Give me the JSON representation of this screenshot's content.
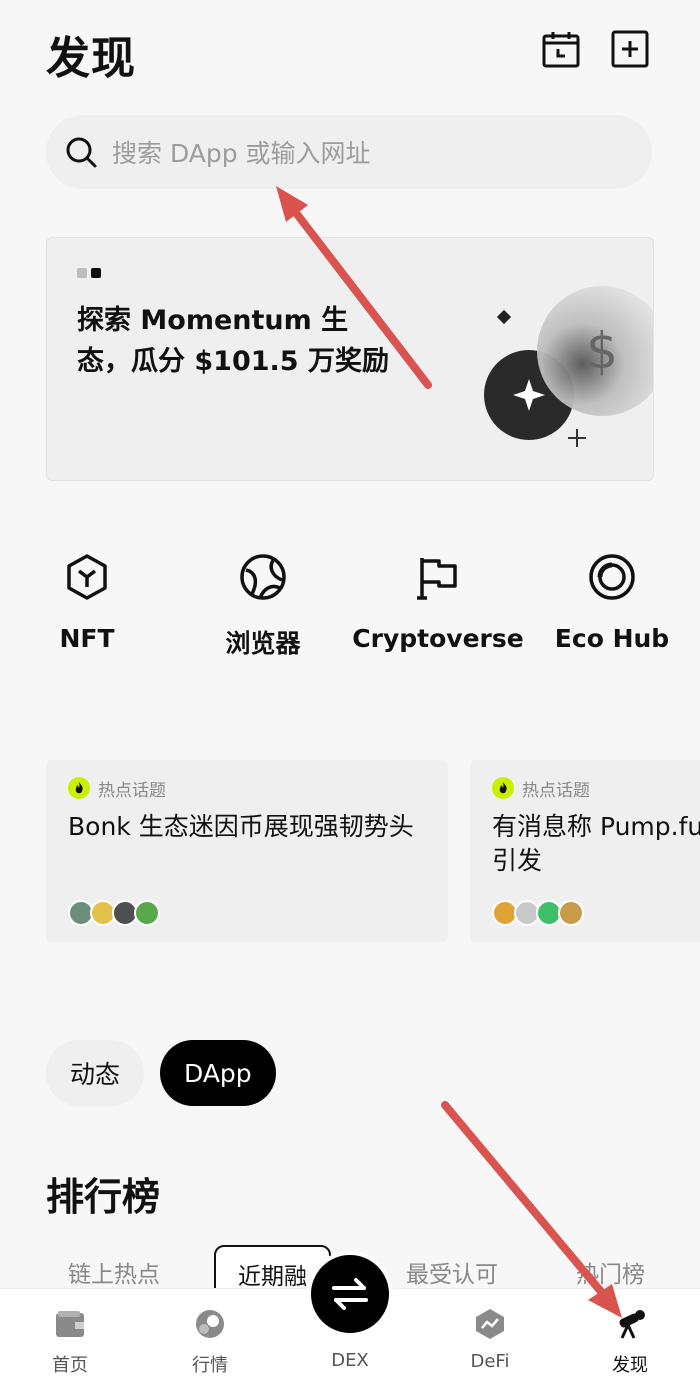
{
  "header": {
    "title": "发现",
    "icons": [
      "calendar-icon",
      "add-box-icon"
    ]
  },
  "search": {
    "placeholder": "搜索 DApp 或输入网址"
  },
  "banner": {
    "text": "探索 Momentum 生态，瓜分 $101.5 万奖励",
    "slide_count": 2,
    "active_slide": 2
  },
  "shortcuts": [
    {
      "label": "NFT",
      "icon": "cube-icon"
    },
    {
      "label": "浏览器",
      "icon": "globe-icon"
    },
    {
      "label": "Cryptoverse",
      "icon": "flag-icon"
    },
    {
      "label": "Eco Hub",
      "icon": "circle-target-icon"
    }
  ],
  "topics": [
    {
      "tag": "热点话题",
      "title": "Bonk 生态迷因币展现强韧势头"
    },
    {
      "tag": "热点话题",
      "title": "有消息称 Pump.fun 亿估值发币，引发"
    }
  ],
  "feed_tabs": {
    "items": [
      "动态",
      "DApp"
    ],
    "active": "DApp"
  },
  "ranking": {
    "title": "排行榜",
    "tabs": [
      "链上热点",
      "近期融",
      "最受认可",
      "热门榜"
    ],
    "selected": "近期融"
  },
  "bottom_nav": [
    {
      "label": "首页",
      "icon": "wallet-icon"
    },
    {
      "label": "行情",
      "icon": "chart-icon"
    },
    {
      "label": "DEX",
      "icon": "swap-icon"
    },
    {
      "label": "DeFi",
      "icon": "defi-icon"
    },
    {
      "label": "发现",
      "icon": "telescope-icon"
    }
  ],
  "colors": {
    "accent_green": "#c8f000",
    "annotation_arrow": "#d9534f",
    "black": "#000000"
  }
}
